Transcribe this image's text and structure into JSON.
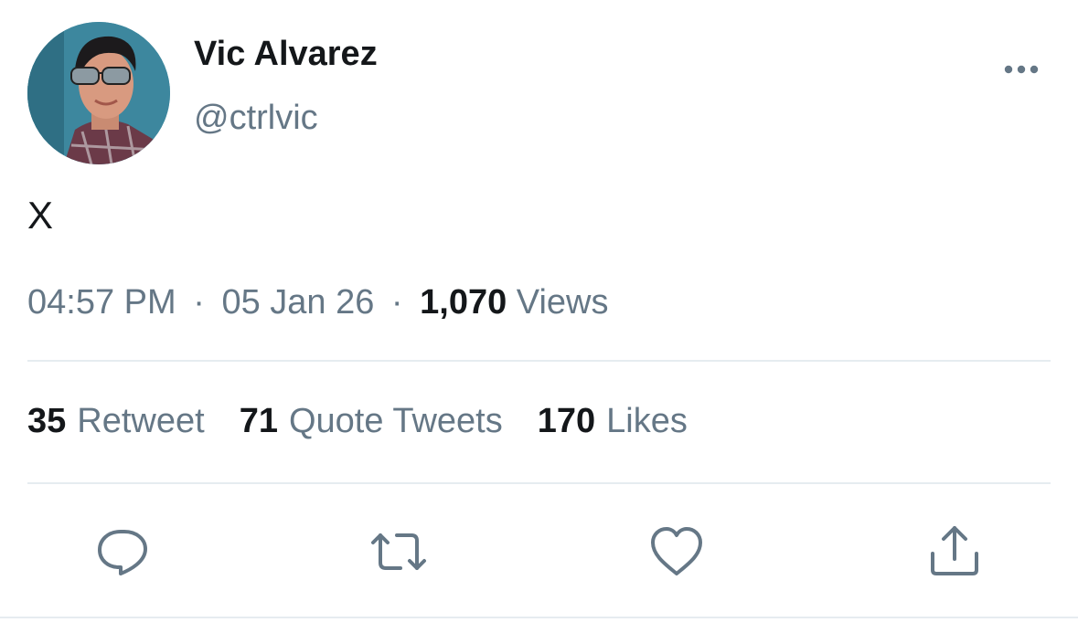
{
  "user": {
    "display_name": "Vic Alvarez",
    "handle": "@ctrlvic"
  },
  "tweet": {
    "text": "X",
    "time": "04:57 PM",
    "date": "05 Jan 26",
    "separator": "·",
    "views_count": "1,070",
    "views_label": "Views"
  },
  "stats": {
    "retweets_count": "35",
    "retweets_label": "Retweet",
    "quotes_count": "71",
    "quotes_label": "Quote Tweets",
    "likes_count": "170",
    "likes_label": "Likes"
  },
  "icons": {
    "more": "more-horizontal-icon",
    "reply": "reply-icon",
    "retweet": "retweet-icon",
    "like": "heart-icon",
    "share": "share-icon"
  },
  "colors": {
    "text_primary": "#14171a",
    "text_secondary": "#657786",
    "divider": "#e6ecf0"
  }
}
